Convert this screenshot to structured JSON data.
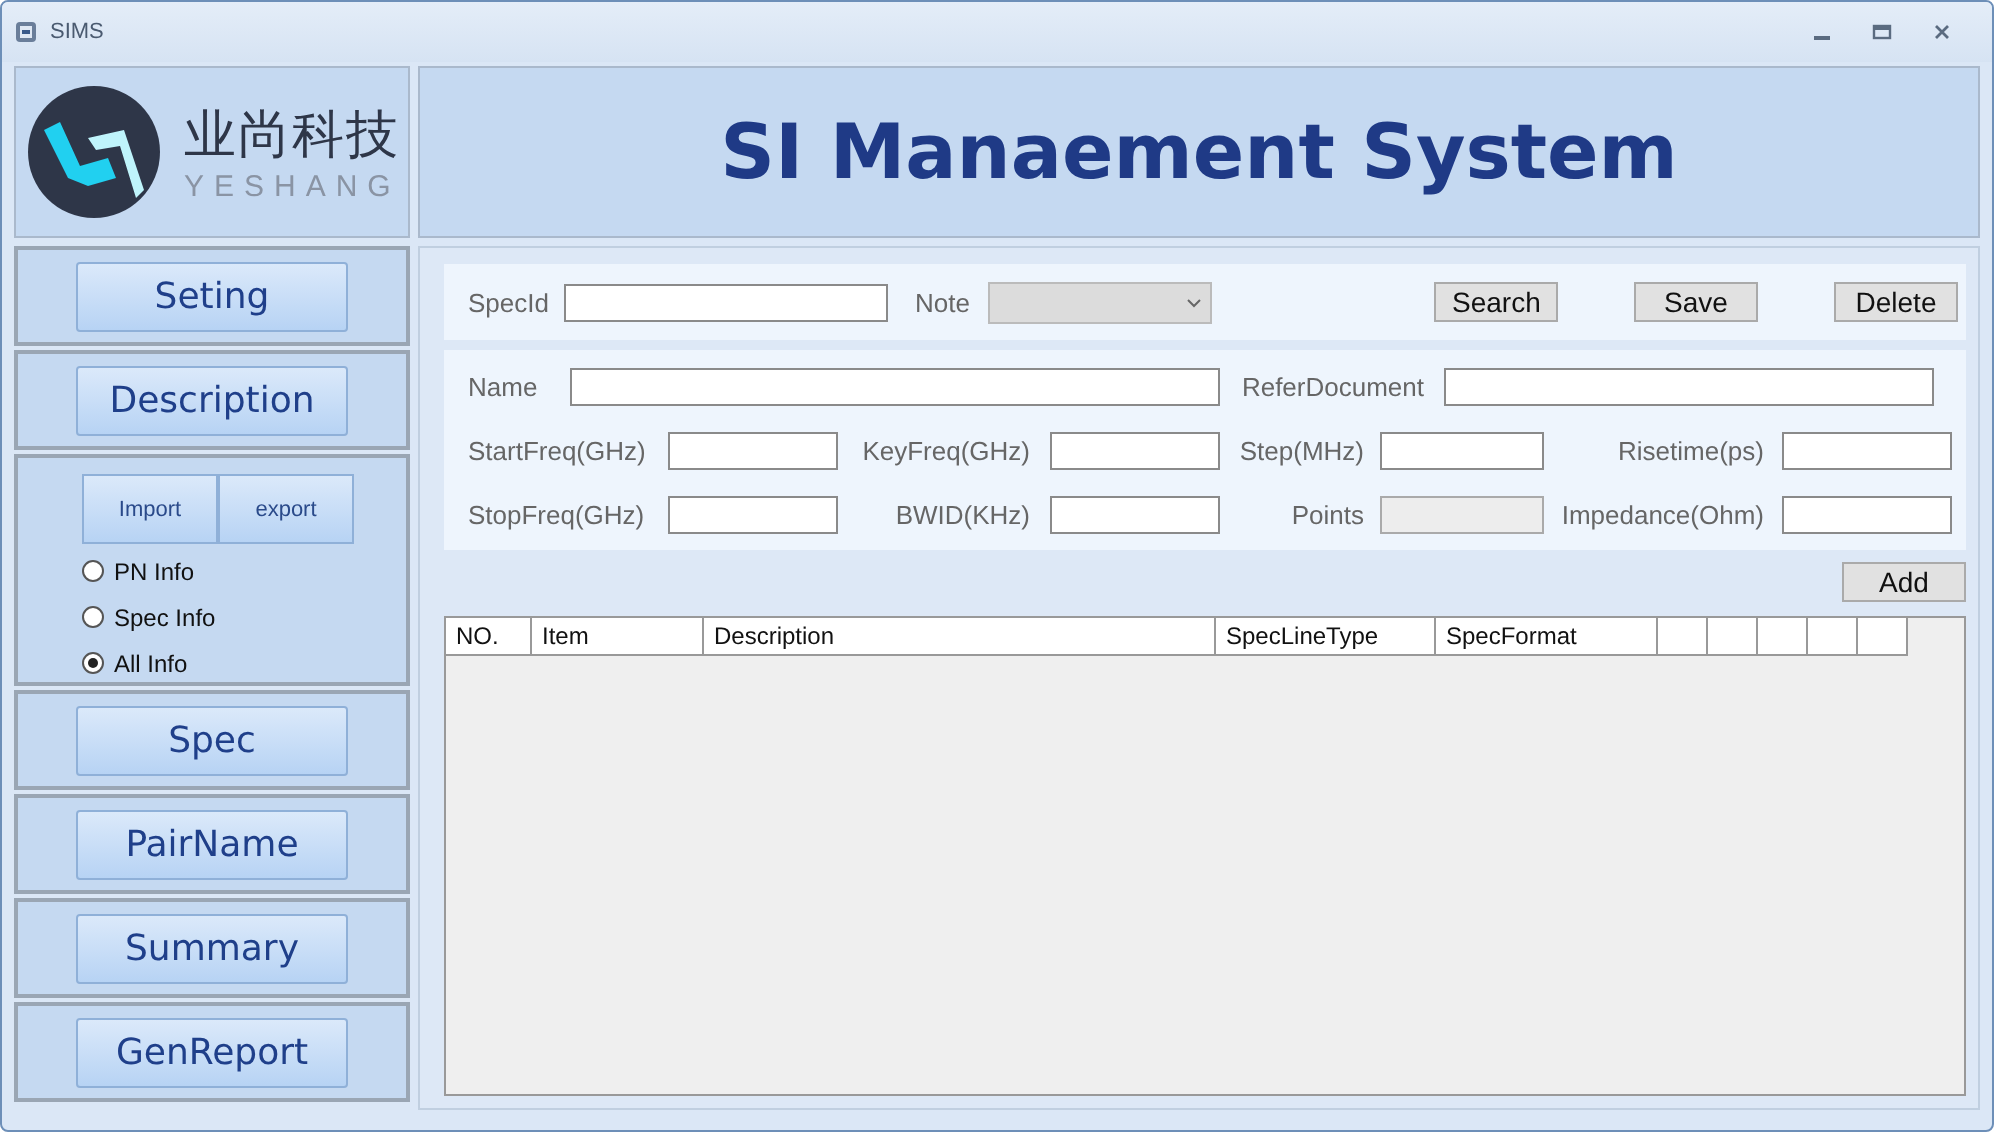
{
  "window": {
    "title": "SIMS"
  },
  "logo": {
    "name": "业尚科技",
    "subtitle": "YESHANG"
  },
  "header": {
    "title": "SI Manaement System"
  },
  "sidebar": {
    "sections": [
      {
        "kind": "button",
        "label": "Seting"
      },
      {
        "kind": "button",
        "label": "Description"
      },
      {
        "kind": "transfer",
        "buttons": [
          "Import",
          "export"
        ],
        "options": [
          {
            "label": "PN Info",
            "selected": false
          },
          {
            "label": "Spec Info",
            "selected": false
          },
          {
            "label": "All Info",
            "selected": true
          }
        ]
      },
      {
        "kind": "button",
        "label": "Spec"
      },
      {
        "kind": "button",
        "label": "PairName"
      },
      {
        "kind": "button",
        "label": "Summary"
      },
      {
        "kind": "button",
        "label": "GenReport"
      }
    ]
  },
  "search_bar": {
    "spec_id_label": "SpecId",
    "note_label": "Note",
    "note_disabled": true,
    "buttons": [
      "Search",
      "Save",
      "Delete"
    ]
  },
  "form": {
    "name_field": {
      "label": "Name",
      "disabled": false
    },
    "refer_field": {
      "label": "ReferDocument",
      "disabled": false
    },
    "rows": [
      [
        {
          "label": "StartFreq(GHz)",
          "disabled": false
        },
        {
          "label": "KeyFreq(GHz)",
          "disabled": false
        },
        {
          "label": "Step(MHz)",
          "disabled": false
        },
        {
          "label": "Risetime(ps)",
          "disabled": false
        }
      ],
      [
        {
          "label": "StopFreq(GHz)",
          "disabled": false
        },
        {
          "label": "BWID(KHz)",
          "disabled": false
        },
        {
          "label": "Points",
          "disabled": true
        },
        {
          "label": "Impedance(Ohm)",
          "disabled": false
        }
      ]
    ]
  },
  "add_button": "Add",
  "table": {
    "columns": [
      "NO.",
      "Item",
      "Description",
      "SpecLineType",
      "SpecFormat"
    ]
  }
}
